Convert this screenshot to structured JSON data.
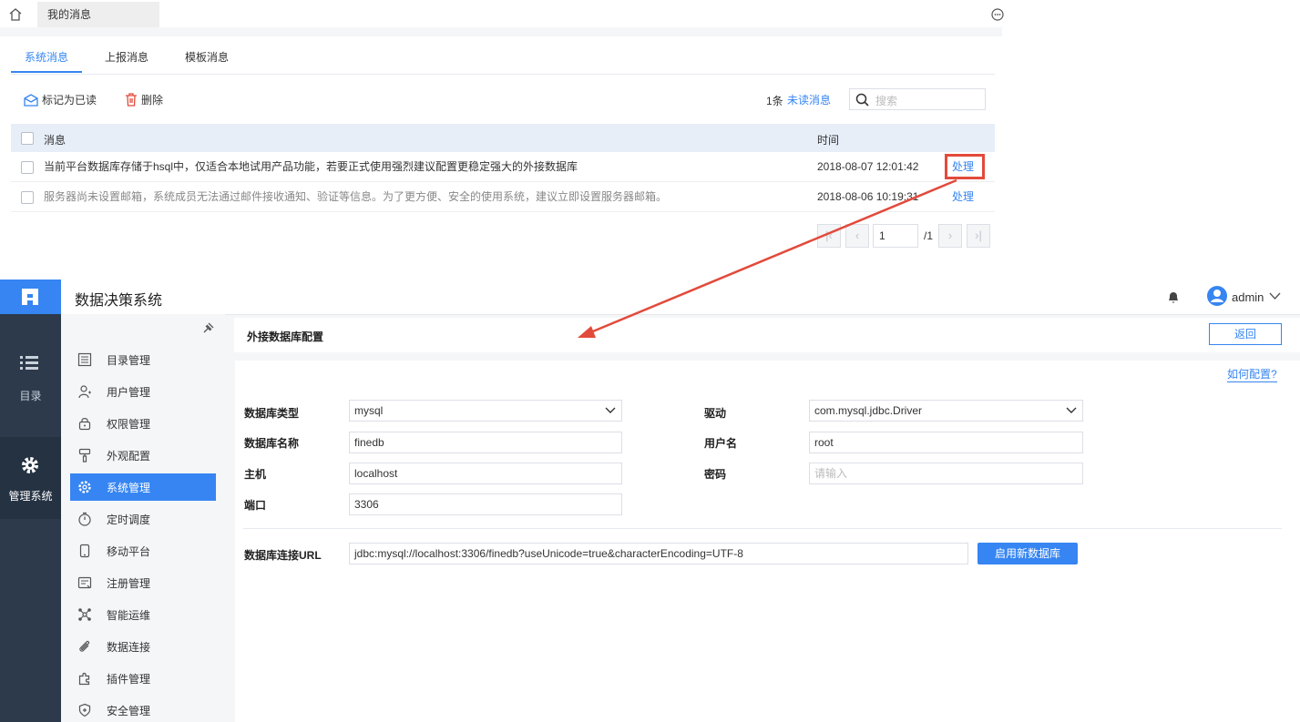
{
  "top": {
    "tab_label": "我的消息",
    "subtabs": [
      "系统消息",
      "上报消息",
      "模板消息"
    ],
    "toolbar": {
      "mark_read": "标记为已读",
      "delete": "删除"
    },
    "unread": {
      "count": "1条",
      "link": "未读消息"
    },
    "search": {
      "placeholder": "搜索"
    },
    "table": {
      "headers": {
        "message": "消息",
        "time": "时间"
      },
      "rows": [
        {
          "message": "当前平台数据库存储于hsql中，仅适合本地试用产品功能，若要正式使用强烈建议配置更稳定强大的外接数据库",
          "time": "2018-08-07 12:01:42",
          "action": "处理"
        },
        {
          "message": "服务器尚未设置邮箱，系统成员无法通过邮件接收通知、验证等信息。为了更方便、安全的使用系统，建议立即设置服务器邮箱。",
          "time": "2018-08-06 10:19:31",
          "action": "处理"
        }
      ]
    },
    "pagination": {
      "current": "1",
      "total": "/1"
    }
  },
  "app": {
    "title": "数据决策系统",
    "user": "admin",
    "rail": {
      "catalog": "目录",
      "admin": "管理系统"
    },
    "menu": [
      {
        "label": "目录管理",
        "icon": "list-icon"
      },
      {
        "label": "用户管理",
        "icon": "user-icon"
      },
      {
        "label": "权限管理",
        "icon": "lock-icon"
      },
      {
        "label": "外观配置",
        "icon": "brush-icon"
      },
      {
        "label": "系统管理",
        "icon": "gear-icon"
      },
      {
        "label": "定时调度",
        "icon": "timer-icon"
      },
      {
        "label": "移动平台",
        "icon": "mobile-icon"
      },
      {
        "label": "注册管理",
        "icon": "register-icon"
      },
      {
        "label": "智能运维",
        "icon": "ops-icon"
      },
      {
        "label": "数据连接",
        "icon": "link-icon"
      },
      {
        "label": "插件管理",
        "icon": "plugin-icon"
      },
      {
        "label": "安全管理",
        "icon": "shield-icon"
      }
    ],
    "active_menu": "系统管理"
  },
  "content": {
    "title": "外接数据库配置",
    "back": "返回",
    "howto": "如何配置?",
    "form": {
      "db_type": {
        "label": "数据库类型",
        "value": "mysql"
      },
      "driver": {
        "label": "驱动",
        "value": "com.mysql.jdbc.Driver"
      },
      "db_name": {
        "label": "数据库名称",
        "value": "finedb"
      },
      "username": {
        "label": "用户名",
        "value": "root"
      },
      "host": {
        "label": "主机",
        "value": "localhost"
      },
      "password": {
        "label": "密码",
        "placeholder": "请输入"
      },
      "port": {
        "label": "端口",
        "value": "3306"
      },
      "url": {
        "label": "数据库连接URL",
        "value": "jdbc:mysql://localhost:3306/finedb?useUnicode=true&characterEncoding=UTF-8"
      }
    },
    "enable_button": "启用新数据库"
  },
  "colors": {
    "accent": "#3685f2",
    "rail": "#2d3a4b",
    "highlight": "#e24a3b"
  }
}
